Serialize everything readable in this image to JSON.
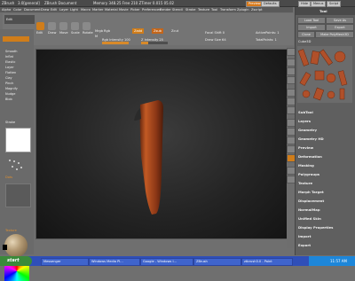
{
  "title_bar": {
    "app": "ZBrush",
    "version": "3.0[general]",
    "document": "ZBrush Document",
    "mem": "Memory 348.25 Free 210 ZTimer 0.015 05.02",
    "buttons": [
      "Preview",
      "Defaults",
      "Hide",
      "Menus",
      "Script"
    ]
  },
  "menubar": [
    "Alpha",
    "Color",
    "Document",
    "Draw",
    "Edit",
    "Layer",
    "Light",
    "Macro",
    "Marker",
    "Material",
    "Movie",
    "Picker",
    "Preferences",
    "Render",
    "Stencil",
    "Stroke",
    "Texture",
    "Tool",
    "Transform",
    "Zplugin",
    "Zscript"
  ],
  "toolbar": {
    "left_items": [
      "Edit",
      "Draw",
      "Move",
      "Scale",
      "Rotate"
    ],
    "mrgb": "Mrgb",
    "rgb": "Rgb",
    "m": "M",
    "zadd": "Zadd",
    "zsub": "Zsub",
    "zcut": "Zcut",
    "rgb_intensity": "Rgb Intensity 100",
    "z_intensity": "Z Intensity 25",
    "focal_shift": "Focal Shift 0",
    "draw_size": "Draw Size 64",
    "active_points": "ActivePoints: 1",
    "total_points": "TotalPoints: 1",
    "rgb_intensity_level": 1.0,
    "z_intensity_level": 0.25
  },
  "left_panel": {
    "items": [
      "Smooth",
      "Inflat",
      "Elastic",
      "Layer",
      "Flatten",
      "Clay",
      "Pinch",
      "Magnify",
      "Nudge",
      "Blob"
    ],
    "stroke_label": "Stroke",
    "dots_label": "Dots",
    "texture_label": "Texture",
    "material_label": "Material",
    "gradient_label": "Gradient"
  },
  "right_panel": {
    "title": "Tool",
    "buttons": [
      "Load Tool",
      "Save As",
      "Import",
      "Export",
      "Clone",
      "Make PolyMesh3D"
    ],
    "tool_name": "Cube3D",
    "sections": [
      "SubTool",
      "Layers",
      "Geometry",
      "Geometry HD",
      "Preview",
      "Deformation",
      "Masking",
      "Polygroups",
      "Texture",
      "Morph Target",
      "Displacement",
      "NormalMap",
      "Unified Skin",
      "Display Properties",
      "Import",
      "Export"
    ],
    "accent": "#d0761a"
  },
  "taskbar": {
    "start": "start",
    "tasks": [
      "Messenger",
      "Windows Media Pl...",
      "Google - Windows I...",
      "ZBrush",
      "ztbrush3.0 - Paint"
    ],
    "clock": "11:57 AM"
  }
}
